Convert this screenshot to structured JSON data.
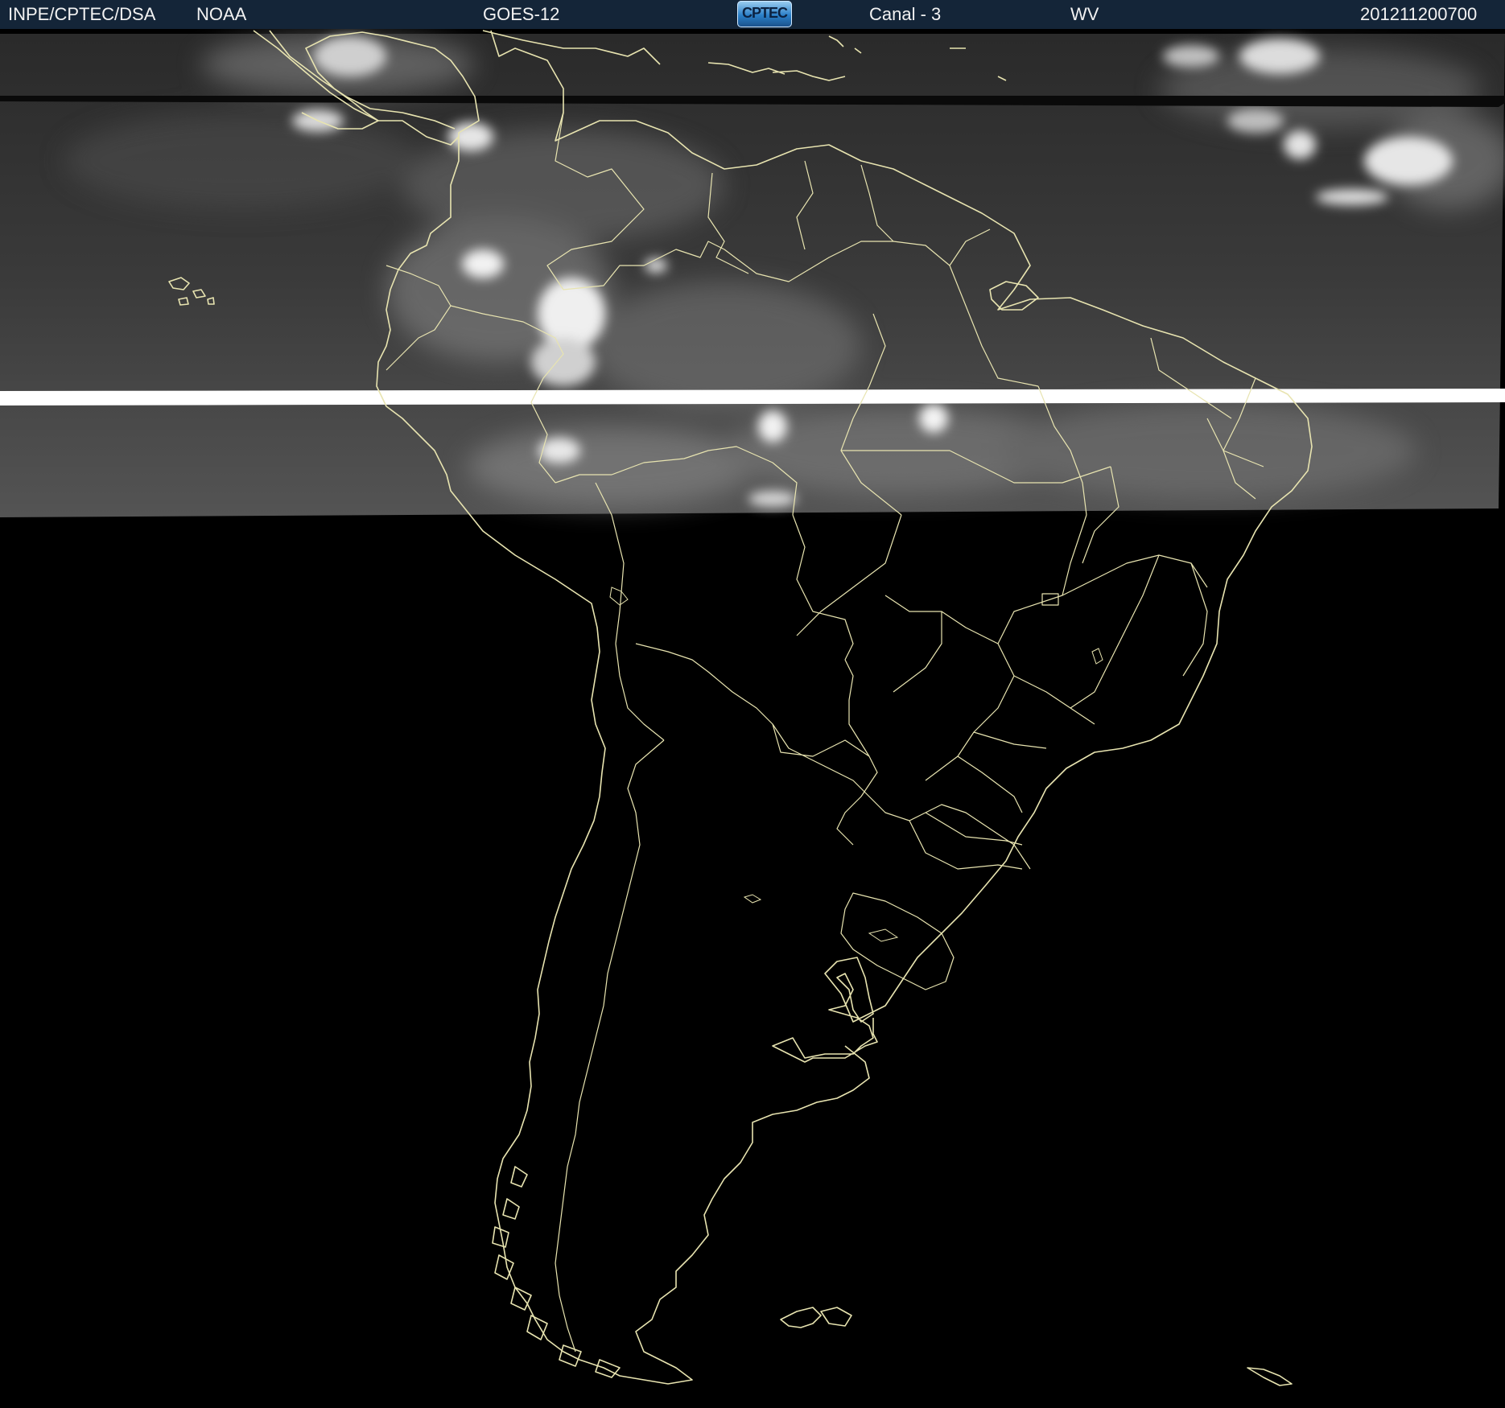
{
  "header": {
    "institution": "INPE/CPTEC/DSA",
    "agency": "NOAA",
    "satellite": "GOES-12",
    "logo_text": "CPTEC",
    "channel": "Canal - 3",
    "band": "WV",
    "timestamp": "201211200700"
  },
  "colors": {
    "header_bg": "#142538",
    "header_text": "#f2f2f2",
    "coastline": "#e8e4b0",
    "background": "#000000"
  }
}
